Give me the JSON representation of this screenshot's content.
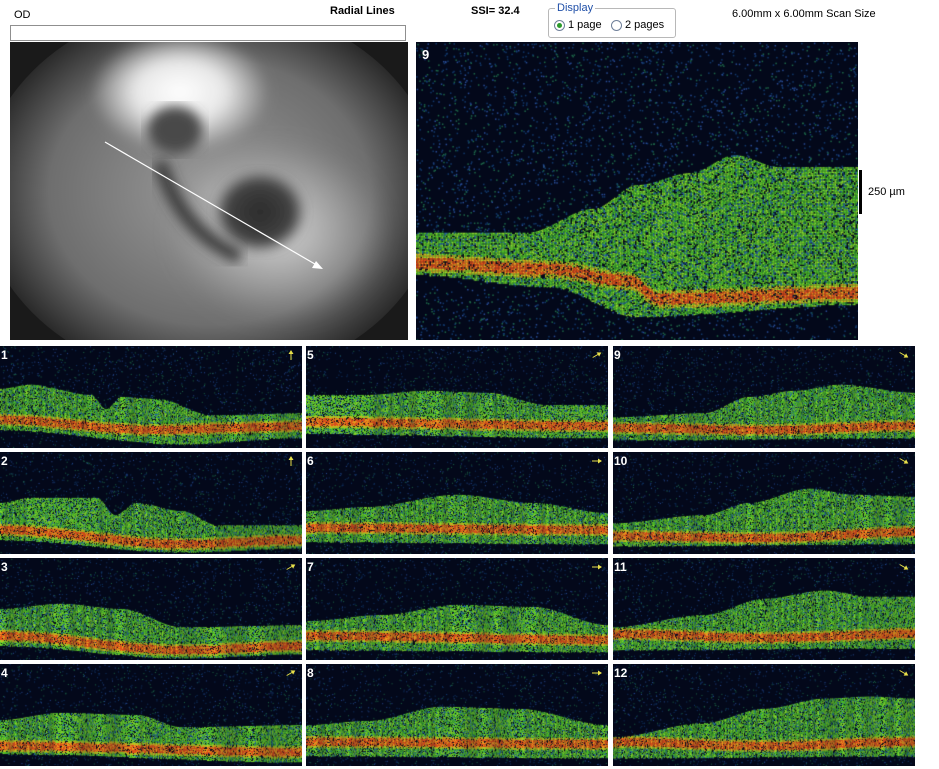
{
  "header": {
    "eye": "OD",
    "scan_type": "Radial Lines",
    "ssi": "SSI= 32.4",
    "scan_size": "6.00mm x 6.00mm Scan Size"
  },
  "display": {
    "legend": "Display",
    "options": [
      {
        "label": "1 page",
        "checked": true
      },
      {
        "label": "2 pages",
        "checked": false
      }
    ]
  },
  "large_scan": {
    "number": "9",
    "scale_label": "250 µm"
  },
  "tiles": [
    {
      "number": "1",
      "direction": "up"
    },
    {
      "number": "2",
      "direction": "up"
    },
    {
      "number": "3",
      "direction": "up-right"
    },
    {
      "number": "4",
      "direction": "up-right"
    },
    {
      "number": "5",
      "direction": "up-right"
    },
    {
      "number": "6",
      "direction": "right"
    },
    {
      "number": "7",
      "direction": "right"
    },
    {
      "number": "8",
      "direction": "right"
    },
    {
      "number": "9",
      "direction": "down-right"
    },
    {
      "number": "10",
      "direction": "down-right"
    },
    {
      "number": "11",
      "direction": "down-right"
    },
    {
      "number": "12",
      "direction": "down-right"
    }
  ],
  "colors": {
    "scan_background": "#03081a",
    "retina_green": "#4fc02a",
    "rpe_red": "#e0501c",
    "arrow_yellow": "#e8e04a"
  }
}
